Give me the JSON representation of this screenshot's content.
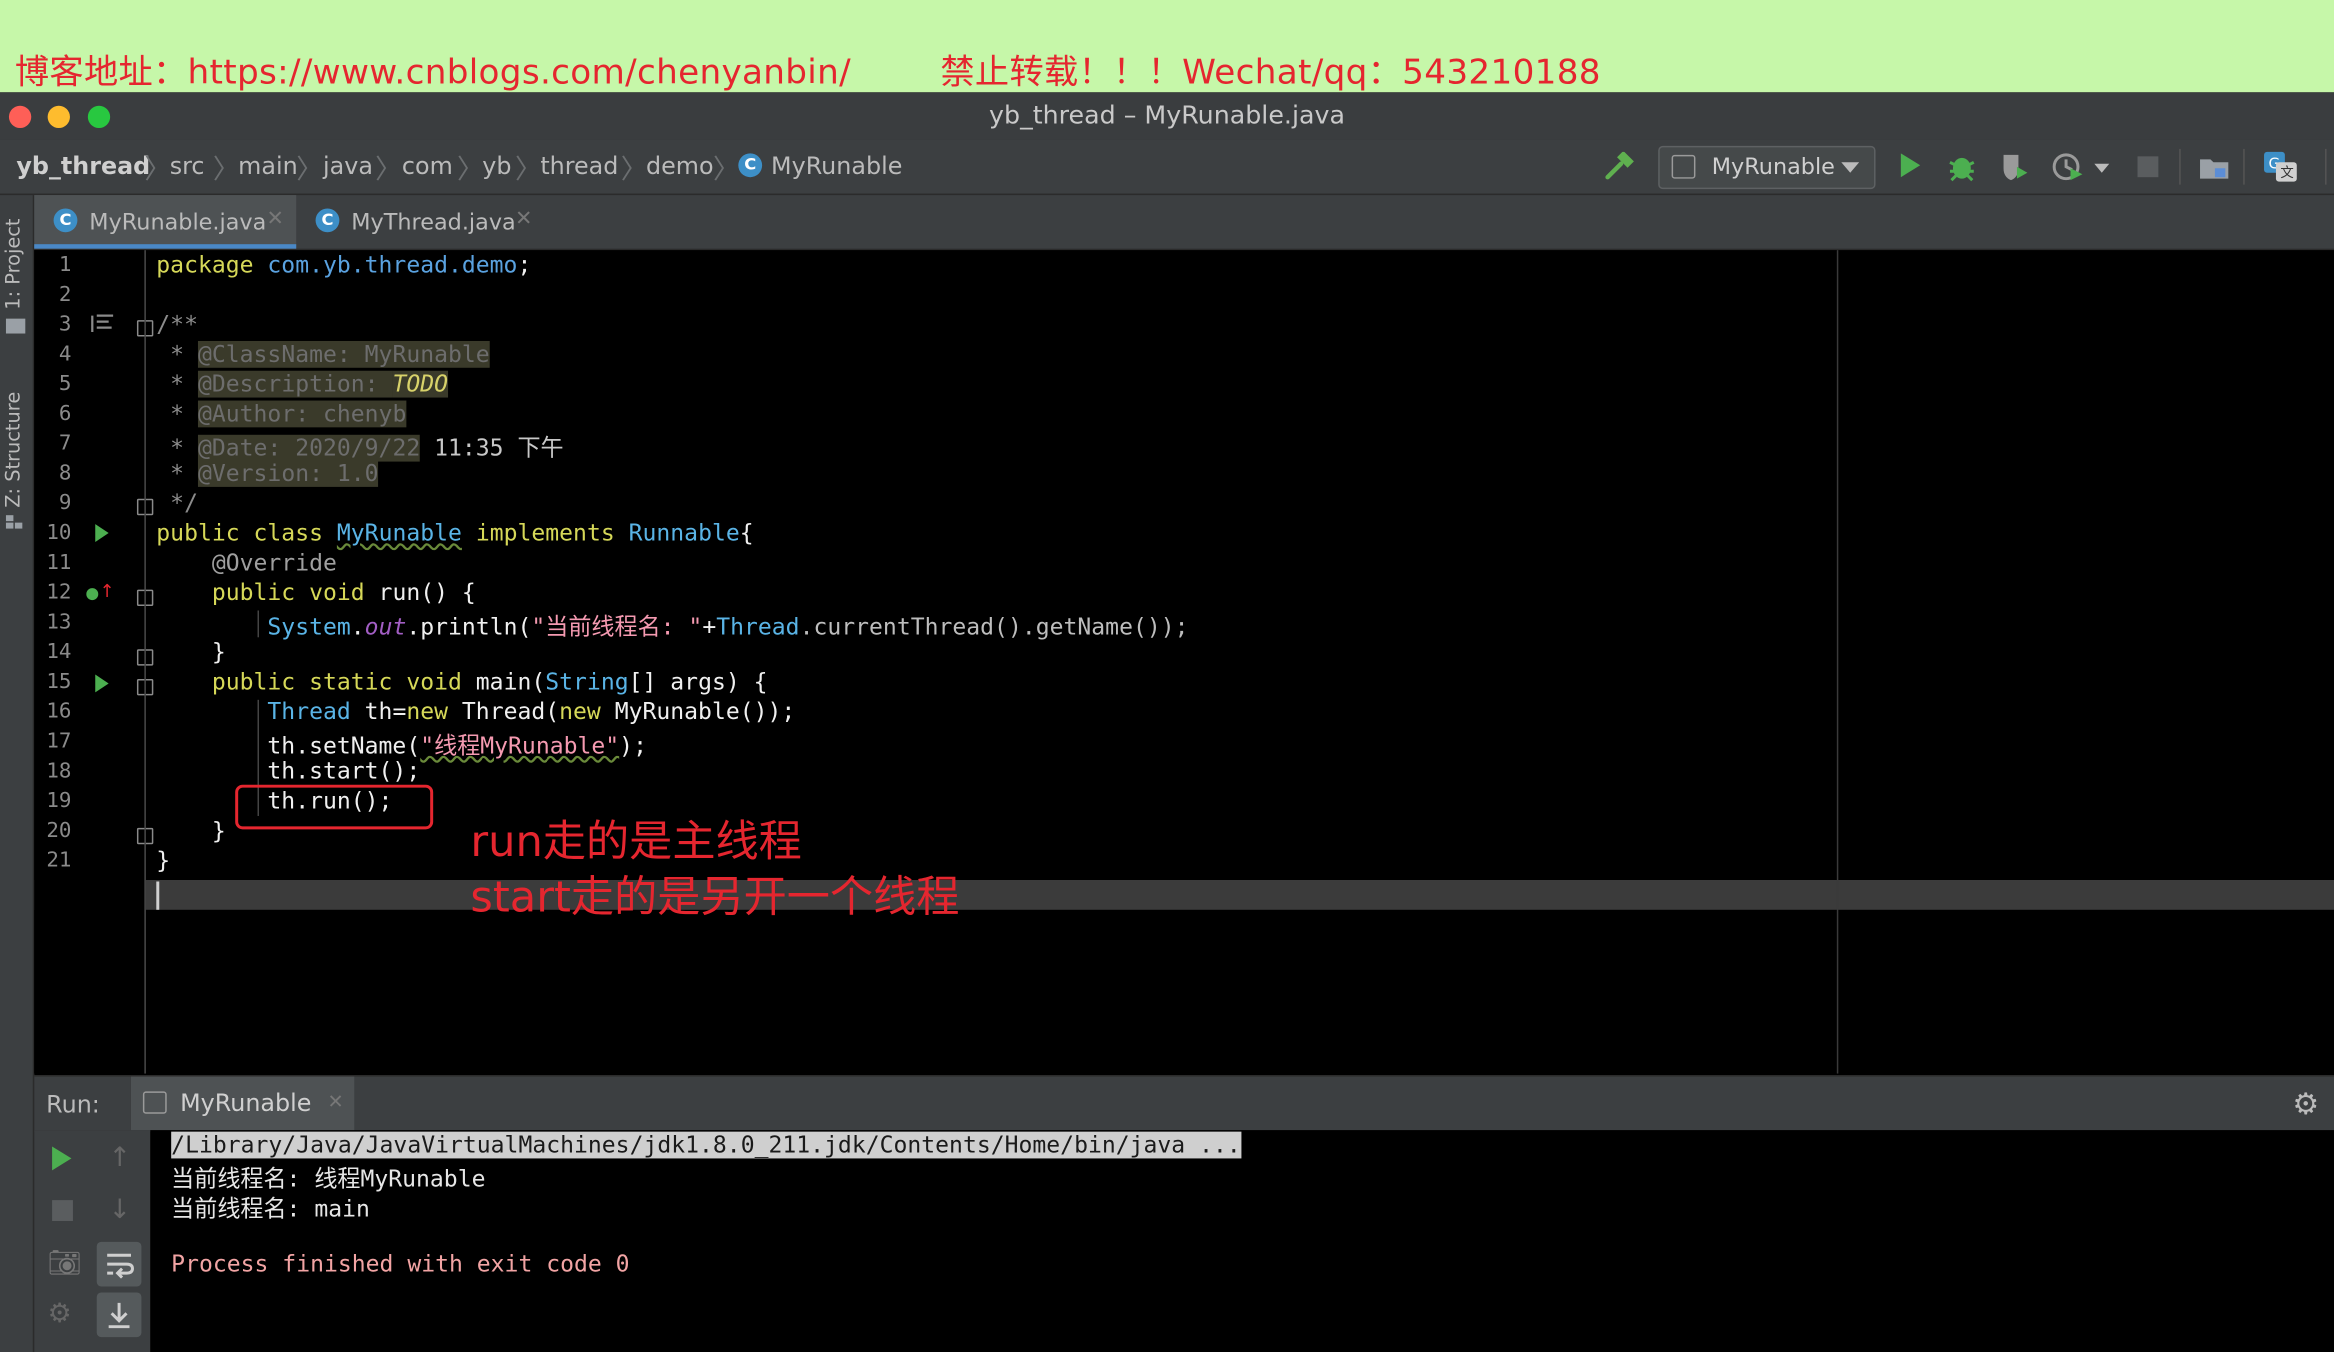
{
  "banner": {
    "text": "博客地址：https://www.cnblogs.com/chenyanbin/        禁止转载！！！Wechat/qq：543210188"
  },
  "window": {
    "title": "yb_thread – MyRunable.java"
  },
  "breadcrumb": [
    "yb_thread",
    "src",
    "main",
    "java",
    "com",
    "yb",
    "thread",
    "demo",
    "MyRunable"
  ],
  "toolbar": {
    "run_config": "MyRunable"
  },
  "tool_windows": {
    "project": "1: Project",
    "structure": "Z: Structure"
  },
  "tabs": [
    {
      "label": "MyRunable.java",
      "active": true
    },
    {
      "label": "MyThread.java",
      "active": false
    }
  ],
  "editor": {
    "line_numbers": [
      "1",
      "2",
      "3",
      "4",
      "5",
      "6",
      "7",
      "8",
      "9",
      "10",
      "11",
      "12",
      "13",
      "14",
      "15",
      "16",
      "17",
      "18",
      "19",
      "20",
      "21"
    ],
    "lines": {
      "l1_a": "package ",
      "l1_b": "com.yb.thread.demo",
      "l1_c": ";",
      "l3": "/**",
      "l4_a": " * ",
      "l4_b": "@ClassName: MyRunable",
      "l5_a": " * ",
      "l5_b": "@Description: ",
      "l5_c": "TODO",
      "l6_a": " * ",
      "l6_b": "@Author: chenyb",
      "l7_a": " * ",
      "l7_b": "@Date: 2020/9/22",
      "l7_c": " 11:35 下午",
      "l8_a": " * ",
      "l8_b": "@Version: 1.0",
      "l9": " */",
      "l10_a": "public class ",
      "l10_b": "MyRunable",
      "l10_c": " implements ",
      "l10_d": "Runnable",
      "l10_e": "{",
      "l11": "    @Override",
      "l12_a": "    public void ",
      "l12_b": "run() {",
      "l13_a": "        ",
      "l13_b": "System",
      "l13_c": ".",
      "l13_d": "out",
      "l13_e": ".println(",
      "l13_f": "\"当前线程名: \"",
      "l13_g": "+",
      "l13_h": "Thread",
      "l13_i": ".currentThread().getName());",
      "l14": "    }",
      "l15_a": "    public static void ",
      "l15_b": "main(",
      "l15_c": "String",
      "l15_d": "[] args) {",
      "l16_a": "        ",
      "l16_b": "Thread",
      "l16_c": " th=",
      "l16_d": "new",
      "l16_e": " Thread(",
      "l16_f": "new",
      "l16_g": " MyRunable());",
      "l17_a": "        th.setName(",
      "l17_b": "\"线程MyRunable\"",
      "l17_c": ");",
      "l18": "        th.start();",
      "l19": "        th.run();",
      "l20": "    }",
      "l21": "}"
    }
  },
  "annotation": {
    "line1": "run走的是主线程",
    "line2": "start走的是另开一个线程"
  },
  "run_panel": {
    "label": "Run:",
    "tab": "MyRunable",
    "output": [
      "/Library/Java/JavaVirtualMachines/jdk1.8.0_211.jdk/Contents/Home/bin/java ...",
      "当前线程名: 线程MyRunable",
      "当前线程名: main",
      "",
      "Process finished with exit code 0"
    ]
  },
  "colors": {
    "banner_bg": "#c6f7a9",
    "annotation_red": "#e5262f",
    "keyword": "#d6d858",
    "run_green": "#4caf50"
  }
}
